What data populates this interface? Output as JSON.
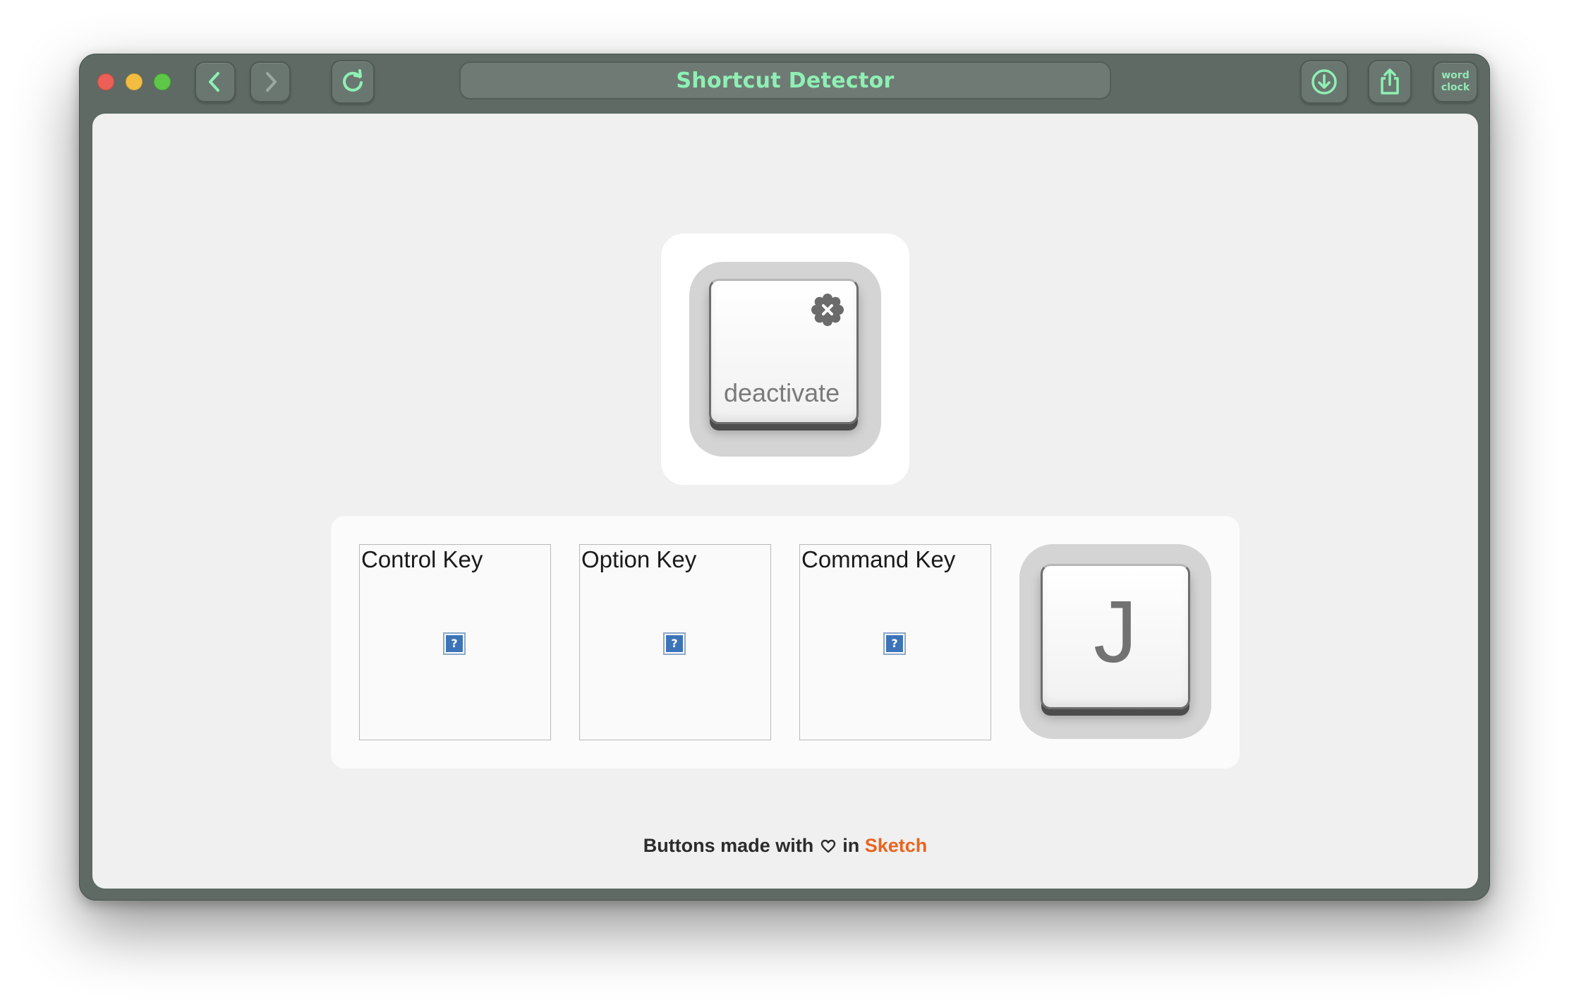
{
  "window": {
    "title": "Shortcut Detector"
  },
  "toolbar": {
    "back_icon": "chevron-left-icon",
    "forward_icon": "chevron-right-icon",
    "reload_icon": "reload-icon",
    "download_icon": "download-icon",
    "share_icon": "share-icon",
    "word_clock": [
      "word",
      "clock"
    ]
  },
  "deactivate_key": {
    "label": "deactivate",
    "badge_icon": "close-badge-icon"
  },
  "modifiers": [
    {
      "label": "Control Key",
      "icon": "missing-image-icon",
      "icon_text": "?"
    },
    {
      "label": "Option Key",
      "icon": "missing-image-icon",
      "icon_text": "?"
    },
    {
      "label": "Command Key",
      "icon": "missing-image-icon",
      "icon_text": "?"
    }
  ],
  "shortcut_key": {
    "letter": "J"
  },
  "footer": {
    "prefix": "Buttons made with",
    "heart_icon": "heart-icon",
    "in": "in",
    "link": "Sketch"
  },
  "colors": {
    "chrome": "#5e6a63",
    "title_text": "#8ef0b4",
    "content_bg": "#f0f0f0",
    "link_accent": "#e8651f",
    "traffic_close": "#ec5f57",
    "traffic_min": "#f3bd42",
    "traffic_max": "#5ec748"
  }
}
